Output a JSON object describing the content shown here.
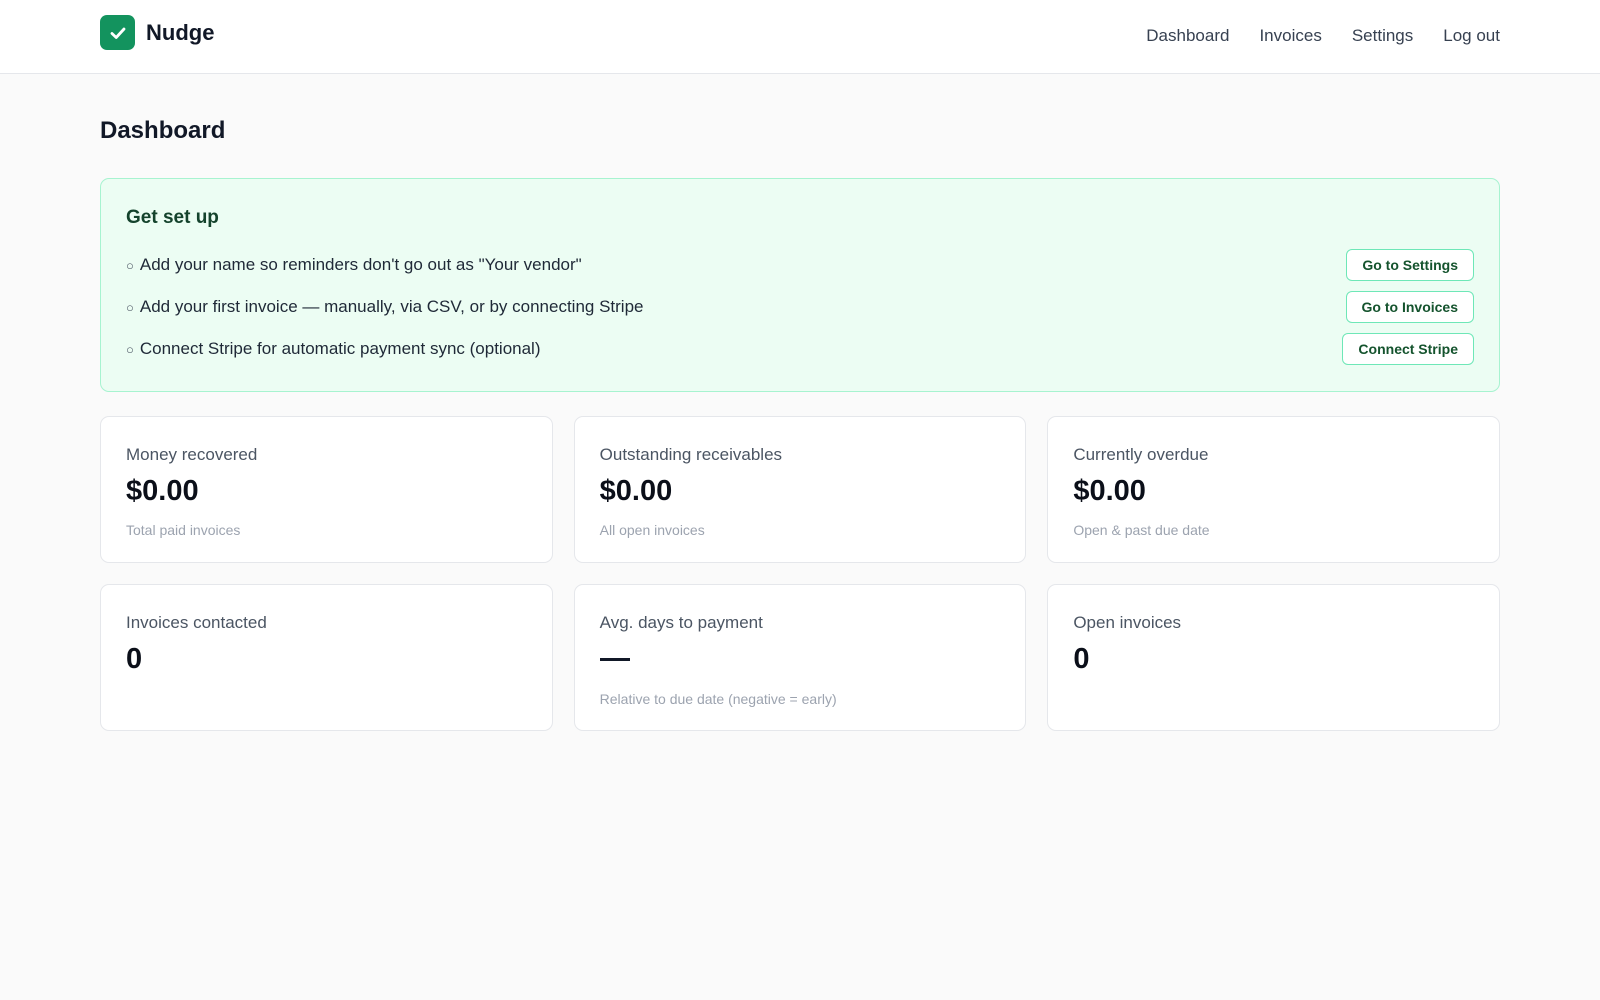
{
  "brand": {
    "name": "Nudge",
    "icon": "check-icon",
    "color": "#13935e"
  },
  "nav": {
    "items": [
      {
        "label": "Dashboard",
        "name": "nav-dashboard"
      },
      {
        "label": "Invoices",
        "name": "nav-invoices"
      },
      {
        "label": "Settings",
        "name": "nav-settings"
      },
      {
        "label": "Log out",
        "name": "nav-logout"
      }
    ]
  },
  "page": {
    "title": "Dashboard"
  },
  "setup": {
    "title": "Get set up",
    "bullet": "○",
    "tasks": [
      {
        "text": "Add your name so reminders don't go out as \"Your vendor\"",
        "button": "Go to Settings"
      },
      {
        "text": "Add your first invoice — manually, via CSV, or by connecting Stripe",
        "button": "Go to Invoices"
      },
      {
        "text": "Connect Stripe for automatic payment sync (optional)",
        "button": "Connect Stripe"
      }
    ]
  },
  "stats": [
    {
      "label": "Money recovered",
      "value": "$0.00",
      "sub": "Total paid invoices"
    },
    {
      "label": "Outstanding receivables",
      "value": "$0.00",
      "sub": "All open invoices"
    },
    {
      "label": "Currently overdue",
      "value": "$0.00",
      "sub": "Open & past due date"
    },
    {
      "label": "Invoices contacted",
      "value": "0",
      "sub": ""
    },
    {
      "label": "Avg. days to payment",
      "value": "—",
      "sub": "Relative to due date (negative = early)"
    },
    {
      "label": "Open invoices",
      "value": "0",
      "sub": ""
    }
  ]
}
